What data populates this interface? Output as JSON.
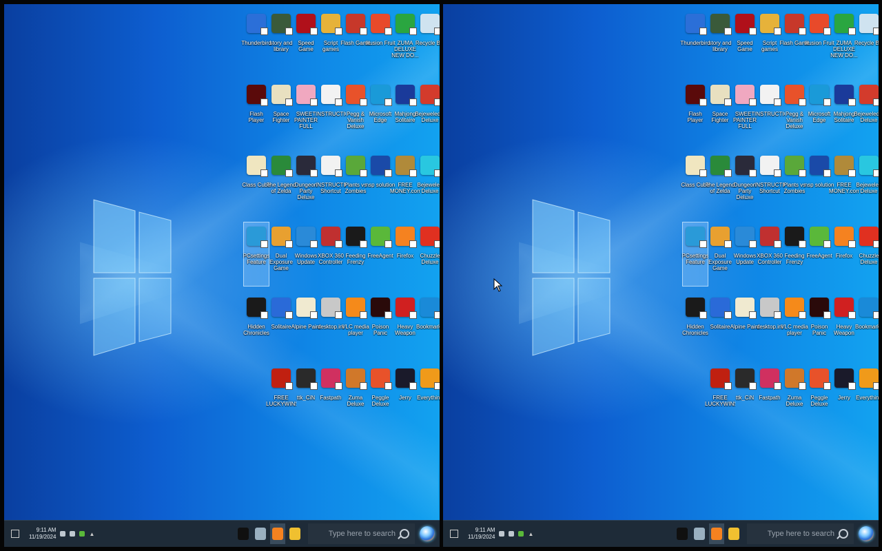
{
  "desktop": {
    "icons": [
      {
        "label": "Recycle Bin",
        "icon": "recycle-bin-icon",
        "color": "#cfe3f0"
      },
      {
        "label": "ZUMA DELUXE NEW DO...",
        "icon": "zuma-icon",
        "color": "#2aa640"
      },
      {
        "label": "Illusion Fruit",
        "icon": "chrome-icon",
        "color": "#e84a2a"
      },
      {
        "label": "Flash Game",
        "icon": "flash-game-icon",
        "color": "#c7382a"
      },
      {
        "label": "Script games",
        "icon": "script-icon",
        "color": "#e6b23a"
      },
      {
        "label": "Speed Game",
        "icon": "flash-icon",
        "color": "#b0101a"
      },
      {
        "label": "story and library",
        "icon": "story-icon",
        "color": "#3a5a3a"
      },
      {
        "label": "Thunderbird",
        "icon": "thunderbird-icon",
        "color": "#2b6fd8"
      },
      {
        "label": "Bejeweled 2 Deluxe",
        "icon": "bejeweled-icon",
        "color": "#d33b2c"
      },
      {
        "label": "Mahjong Solitaire",
        "icon": "mahjong-icon",
        "color": "#1a3a9a"
      },
      {
        "label": "Microsoft Edge",
        "icon": "edge-icon",
        "color": "#1a9ad8"
      },
      {
        "label": "Pegg & Vanish Deluxe",
        "icon": "peggle-icon",
        "color": "#e8522a"
      },
      {
        "label": "INSTRUCTIONS.txt",
        "icon": "document-icon",
        "color": "#f2f2f2"
      },
      {
        "label": "SWEET PAINTER FULL",
        "icon": "anime-girl-icon",
        "color": "#f0a8c0"
      },
      {
        "label": "Space Fighter",
        "icon": "pixel-icon",
        "color": "#e8e0c0"
      },
      {
        "label": "Flash Player",
        "icon": "flash-player-icon",
        "color": "#5a0a0a"
      },
      {
        "label": "Bejeweled Deluxe",
        "icon": "gem-icon",
        "color": "#29c7e0"
      },
      {
        "label": "FREE MONEY.com",
        "icon": "money-bag-icon",
        "color": "#b08a3a"
      },
      {
        "label": "nsp solution",
        "icon": "mpa-icon",
        "color": "#1a4aa8"
      },
      {
        "label": "Plants vs Zombies",
        "icon": "plants-icon",
        "color": "#5aa83a"
      },
      {
        "label": "INSTRUCTIONS Shortcut",
        "icon": "document-icon",
        "color": "#f2f2f2"
      },
      {
        "label": "Dungeon Party Deluxe",
        "icon": "dungeon-icon",
        "color": "#2a2a3a"
      },
      {
        "label": "The Legend of Zelda",
        "icon": "zelda-icon",
        "color": "#2a8a3a"
      },
      {
        "label": "Class Cube",
        "icon": "folder-icon",
        "color": "#f0e6c0"
      },
      {
        "label": "Chuzzle Deluxe",
        "icon": "chuzzle-icon",
        "color": "#e03020"
      },
      {
        "label": "Firefox",
        "icon": "firefox-icon",
        "color": "#f58220"
      },
      {
        "label": "FreeAgent",
        "icon": "frog-icon",
        "color": "#5ab83a"
      },
      {
        "label": "Feeding Frenzy",
        "icon": "frenzy-icon",
        "color": "#1a1a1a"
      },
      {
        "label": "XBOX 360 Controller",
        "icon": "controller-icon",
        "color": "#c03030"
      },
      {
        "label": "Windows Update",
        "icon": "shield-icon",
        "color": "#2a8ad8"
      },
      {
        "label": "Dual Exposure Game",
        "icon": "de-icon",
        "color": "#e8a030"
      },
      {
        "label": "PCsettings Feature",
        "icon": "windows-logo-icon",
        "color": "#2a9ad8",
        "selected": true
      },
      {
        "label": "Bookmarks",
        "icon": "bookmark-icon",
        "color": "#1a8ad8"
      },
      {
        "label": "Heavy Weapon",
        "icon": "radioactive-icon",
        "color": "#d02020"
      },
      {
        "label": "Poison Panic",
        "icon": "poison-icon",
        "color": "#2a0a0a"
      },
      {
        "label": "VLC media player",
        "icon": "vlc-icon",
        "color": "#f58a1a"
      },
      {
        "label": "desktop.ini",
        "icon": "copy-icon",
        "color": "#c8c8c8"
      },
      {
        "label": "Alpine Paint",
        "icon": "paint-icon",
        "color": "#f0ead0"
      },
      {
        "label": "Solitaire",
        "icon": "solitaire-icon",
        "color": "#2a6ad8"
      },
      {
        "label": "Hidden Chronicles",
        "icon": "hidden-icon",
        "color": "#1a1a1a"
      },
      {
        "label": "Everything",
        "icon": "magnifier-icon",
        "color": "#f09a1a"
      },
      {
        "label": "Jerry",
        "icon": "jerry-icon",
        "color": "#1a1a2a"
      },
      {
        "label": "Peggle Deluxe",
        "icon": "peggle2-icon",
        "color": "#e8522a"
      },
      {
        "label": "Zuma Deluxe",
        "icon": "zuma-deluxe-icon",
        "color": "#d0782a"
      },
      {
        "label": "Fastpath",
        "icon": "fastpath-icon",
        "color": "#d03060"
      },
      {
        "label": "ttk_CiN",
        "icon": "ttk-icon",
        "color": "#2a2a2a"
      },
      {
        "label": "FREE LUCKYWINS",
        "icon": "lucky-icon",
        "color": "#c02010"
      }
    ]
  },
  "taskbar": {
    "search_placeholder": "Type here to search",
    "clock_time": "9:11 AM",
    "clock_date": "11/19/2024",
    "apps": [
      {
        "name": "file-explorer-icon",
        "color": "#f0c030",
        "active": false
      },
      {
        "name": "firefox-icon",
        "color": "#f58220",
        "active": true
      },
      {
        "name": "copy-task-icon",
        "color": "#9ab0c0",
        "active": false
      },
      {
        "name": "terminal-icon",
        "color": "#101010",
        "active": false
      }
    ]
  },
  "colors": {
    "taskbar_bg": "#1e2b38",
    "desktop_accent": "#0f86e6"
  }
}
